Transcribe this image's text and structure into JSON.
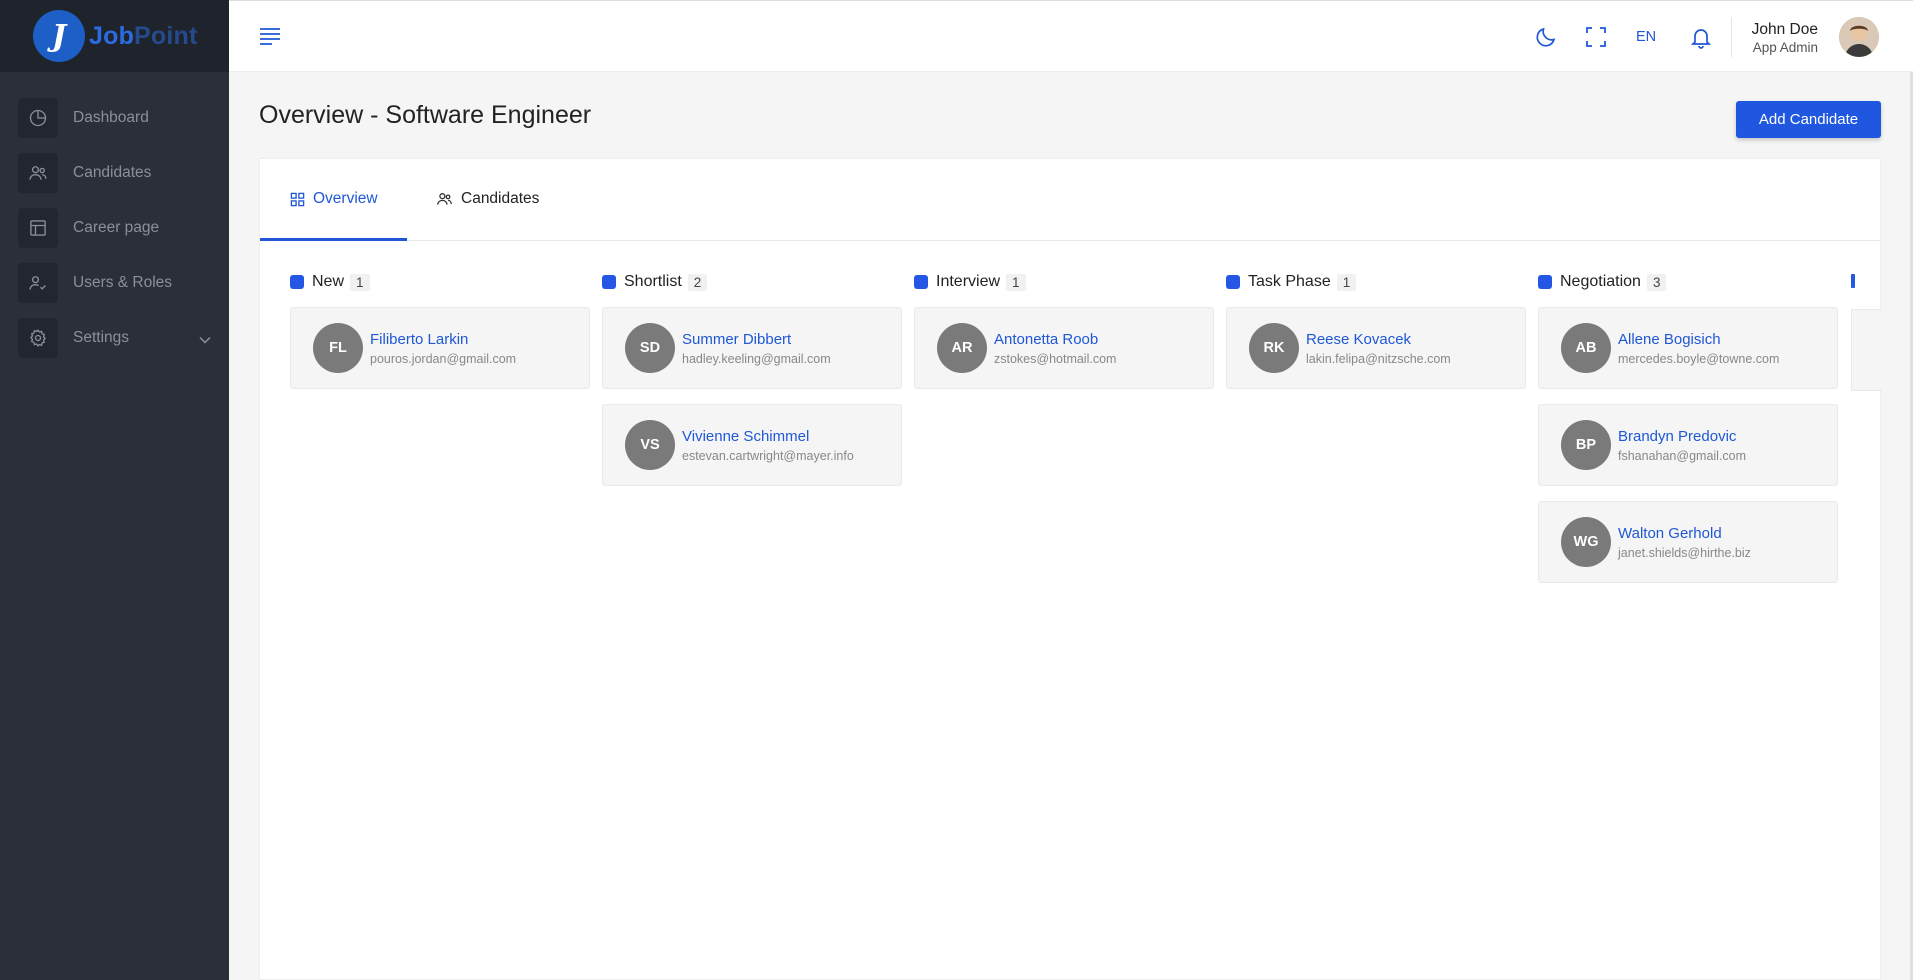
{
  "brand": {
    "letter": "J",
    "name_part1": "Job",
    "name_part2": "Point"
  },
  "sidebar": {
    "items": [
      {
        "label": "Dashboard",
        "icon": "pie-chart-icon"
      },
      {
        "label": "Candidates",
        "icon": "users-icon"
      },
      {
        "label": "Career page",
        "icon": "layout-icon"
      },
      {
        "label": "Users & Roles",
        "icon": "user-check-icon"
      },
      {
        "label": "Settings",
        "icon": "gear-icon",
        "has_submenu": true
      }
    ]
  },
  "topbar": {
    "language": "EN",
    "user": {
      "name": "John Doe",
      "role": "App Admin"
    }
  },
  "page": {
    "title": "Overview - Software Engineer",
    "add_button": "Add Candidate"
  },
  "tabs": [
    {
      "label": "Overview",
      "active": true
    },
    {
      "label": "Candidates",
      "active": false
    }
  ],
  "columns": [
    {
      "name": "New",
      "count": "1",
      "candidates": [
        {
          "initials": "FL",
          "name": "Filiberto Larkin",
          "email": "pouros.jordan@gmail.com"
        }
      ]
    },
    {
      "name": "Shortlist",
      "count": "2",
      "candidates": [
        {
          "initials": "SD",
          "name": "Summer Dibbert",
          "email": "hadley.keeling@gmail.com"
        },
        {
          "initials": "VS",
          "name": "Vivienne Schimmel",
          "email": "estevan.cartwright@mayer.info"
        }
      ]
    },
    {
      "name": "Interview",
      "count": "1",
      "candidates": [
        {
          "initials": "AR",
          "name": "Antonetta Roob",
          "email": "zstokes@hotmail.com"
        }
      ]
    },
    {
      "name": "Task Phase",
      "count": "1",
      "candidates": [
        {
          "initials": "RK",
          "name": "Reese Kovacek",
          "email": "lakin.felipa@nitzsche.com"
        }
      ]
    },
    {
      "name": "Negotiation",
      "count": "3",
      "candidates": [
        {
          "initials": "AB",
          "name": "Allene Bogisich",
          "email": "mercedes.boyle@towne.com"
        },
        {
          "initials": "BP",
          "name": "Brandyn Predovic",
          "email": "fshanahan@gmail.com"
        },
        {
          "initials": "WG",
          "name": "Walton Gerhold",
          "email": "janet.shields@hirthe.biz"
        }
      ]
    }
  ],
  "colors": {
    "accent": "#1f57d6",
    "sidebar_bg": "#2a2f3a",
    "avatar_bg": "#7a7a7a"
  }
}
